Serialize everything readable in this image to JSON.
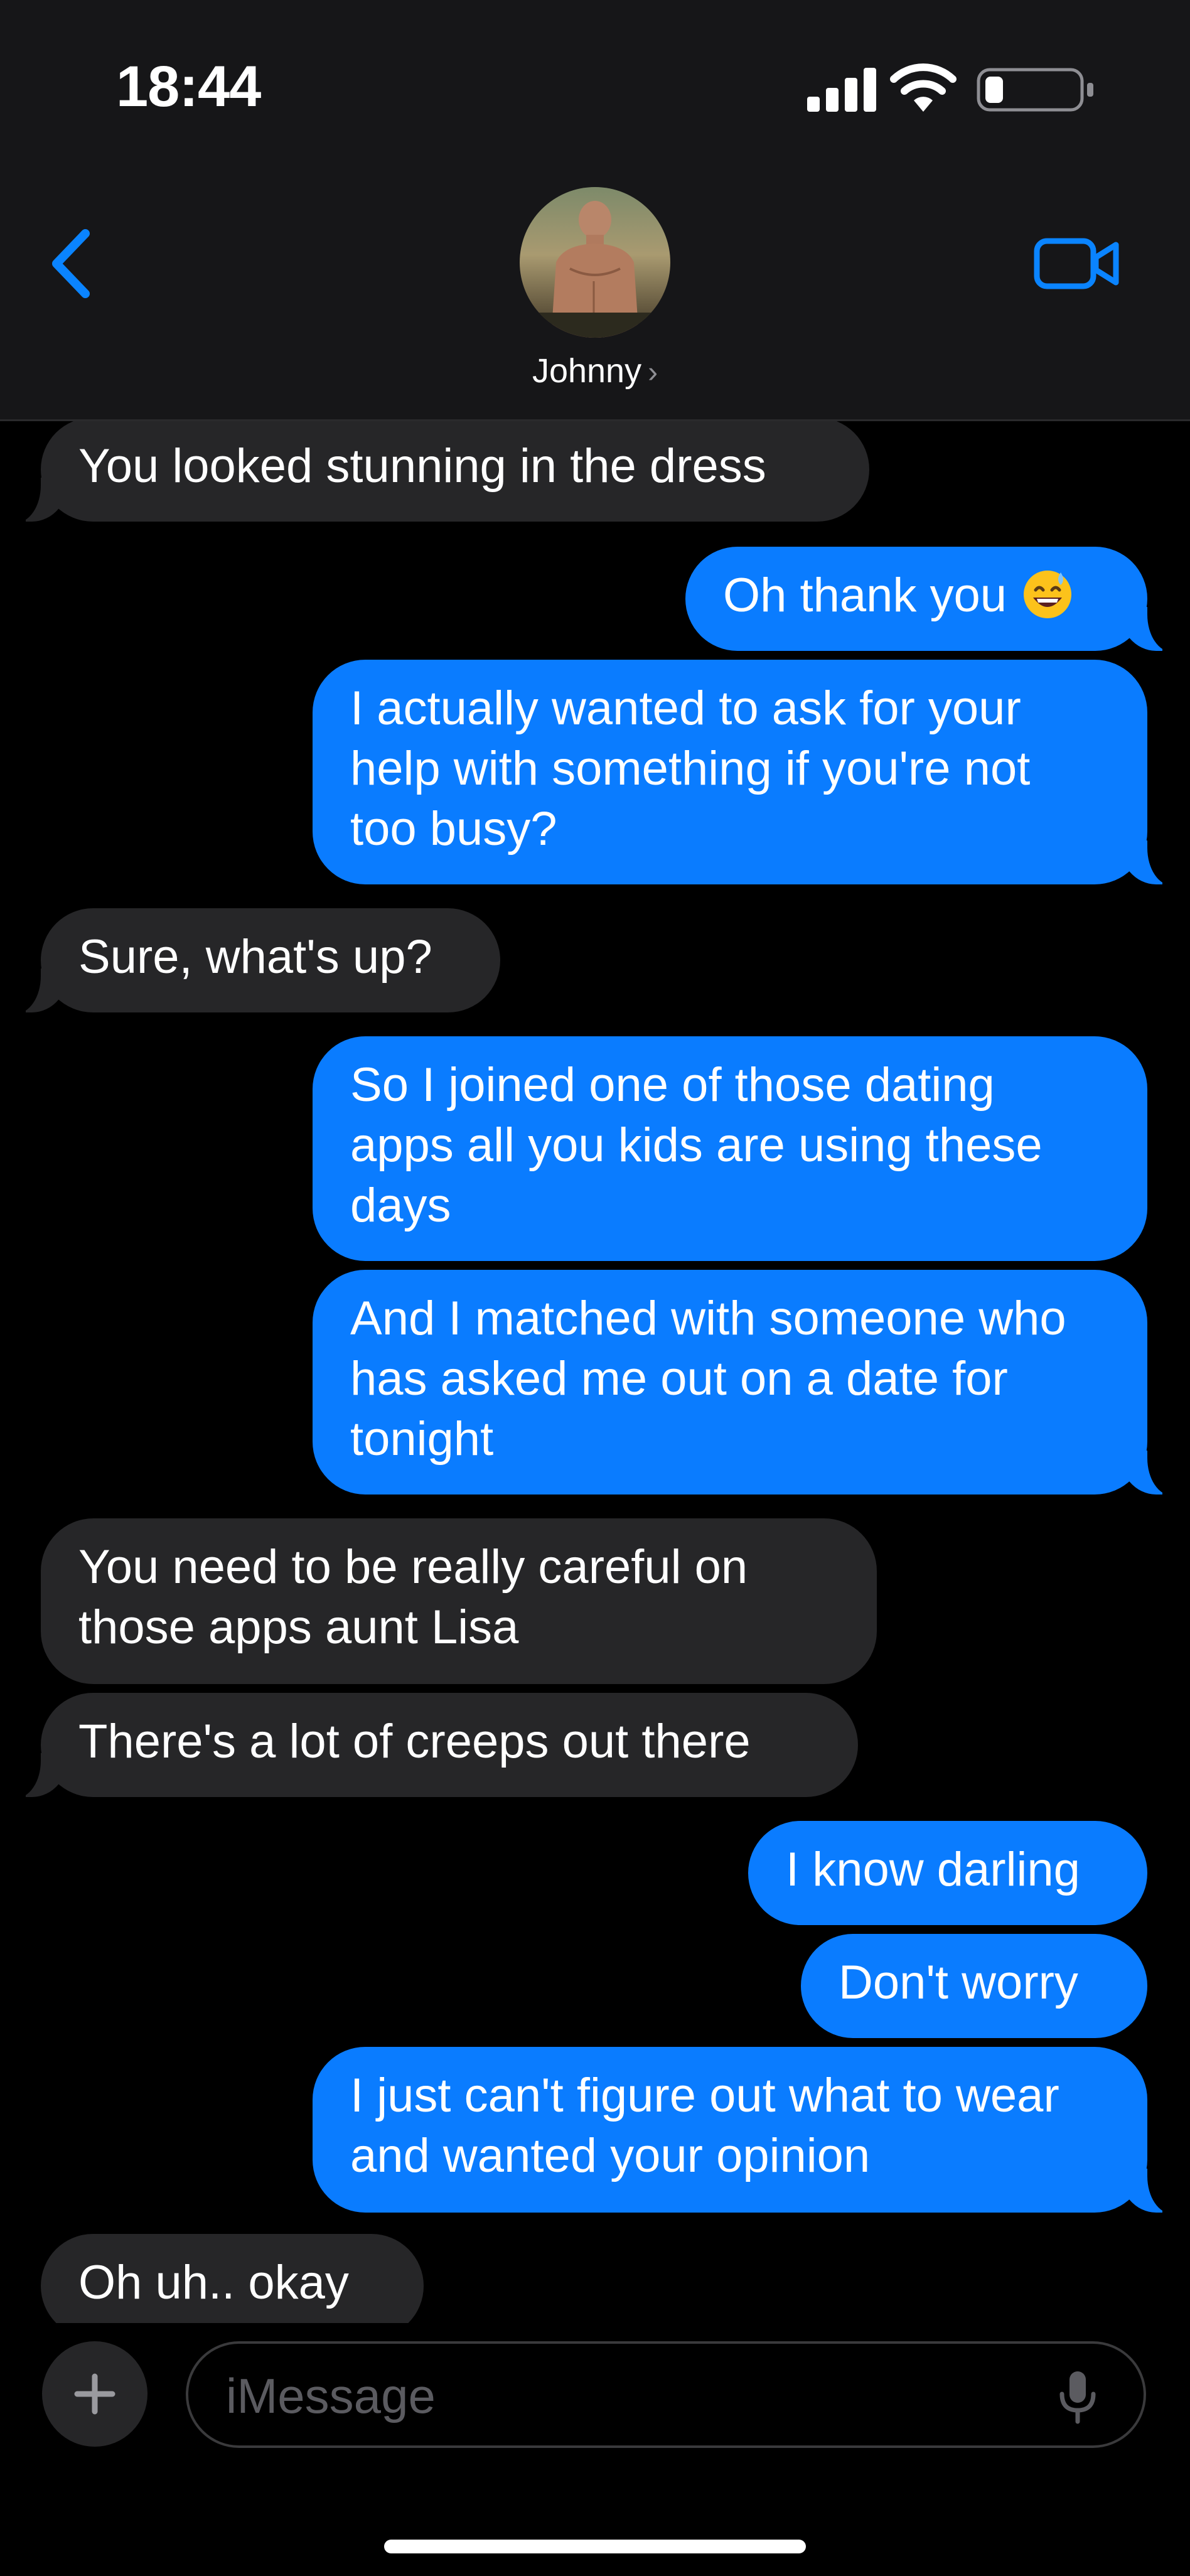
{
  "status_bar": {
    "time": "18:44",
    "battery_level": 0.2
  },
  "header": {
    "contact_name": "Johnny",
    "chevron": "›",
    "back_icon": "chevron-left-icon",
    "video_icon": "video-camera-icon"
  },
  "messages": [
    {
      "direction": "incoming",
      "text": "You looked stunning in the dress"
    },
    {
      "direction": "outgoing",
      "text": "Oh thank you",
      "emoji": "smiling-sweat-emoji"
    },
    {
      "direction": "outgoing",
      "text": "I actually wanted to ask for your help with something if you're not too busy?"
    },
    {
      "direction": "incoming",
      "text": "Sure, what's up?"
    },
    {
      "direction": "outgoing",
      "text": "So I joined one of those dating apps all you kids are using these days"
    },
    {
      "direction": "outgoing",
      "text": "And I matched with someone who has asked me out on a date for tonight"
    },
    {
      "direction": "incoming",
      "text": "You need to be really careful on those apps aunt Lisa"
    },
    {
      "direction": "incoming",
      "text": "There's a lot of creeps out there"
    },
    {
      "direction": "outgoing",
      "text": "I know darling"
    },
    {
      "direction": "outgoing",
      "text": "Don't worry"
    },
    {
      "direction": "outgoing",
      "text": "I just can't figure out what to wear and wanted your opinion"
    },
    {
      "direction": "incoming",
      "text": "Oh uh.. okay"
    }
  ],
  "composer": {
    "placeholder": "iMessage",
    "plus_icon": "plus-icon",
    "mic_icon": "microphone-icon"
  },
  "colors": {
    "outgoing_bubble": "#0a7cff",
    "incoming_bubble": "#262628",
    "accent": "#0a84ff"
  }
}
